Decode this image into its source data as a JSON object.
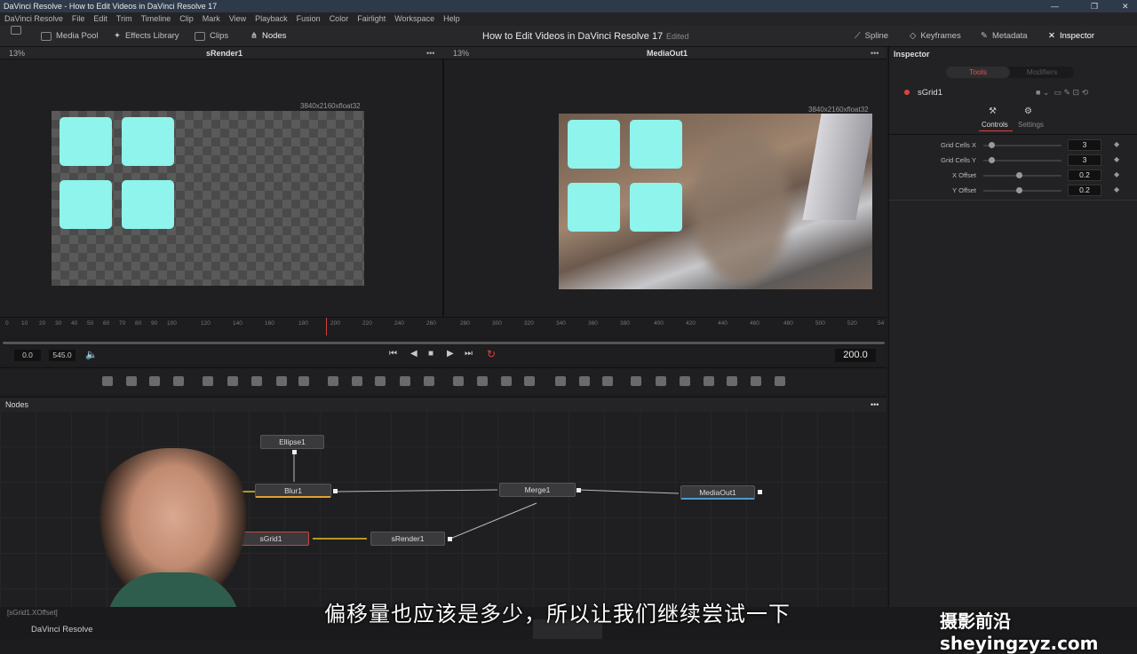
{
  "window": {
    "title": "DaVinci Resolve - How to Edit Videos in DaVinci Resolve 17"
  },
  "menu": [
    "DaVinci Resolve",
    "File",
    "Edit",
    "Trim",
    "Timeline",
    "Clip",
    "Mark",
    "View",
    "Playback",
    "Fusion",
    "Color",
    "Fairlight",
    "Workspace",
    "Help"
  ],
  "toolbar": {
    "media_pool": "Media Pool",
    "effects_library": "Effects Library",
    "clips": "Clips",
    "nodes": "Nodes",
    "project_title": "How to Edit Videos in DaVinci Resolve 17",
    "edited": "Edited",
    "spline": "Spline",
    "keyframes": "Keyframes",
    "metadata": "Metadata",
    "inspector": "Inspector"
  },
  "viewer_left": {
    "zoom": "13%",
    "name": "sRender1",
    "resolution": "3840x2160xfloat32"
  },
  "viewer_right": {
    "zoom": "13%",
    "name": "MediaOut1",
    "resolution": "3840x2160xfloat32"
  },
  "ruler_ticks": [
    "0",
    "10",
    "20",
    "30",
    "40",
    "50",
    "60",
    "70",
    "80",
    "90",
    "100",
    "120",
    "140",
    "160",
    "180",
    "200",
    "220",
    "240",
    "260",
    "280",
    "300",
    "320",
    "340",
    "360",
    "380",
    "400",
    "420",
    "440",
    "460",
    "480",
    "500",
    "520",
    "54"
  ],
  "transport": {
    "start": "0.0",
    "end": "545.0",
    "current": "200.0"
  },
  "nodes_panel": {
    "title": "Nodes",
    "nodes": {
      "ellipse": "Ellipse1",
      "blur": "Blur1",
      "merge": "Merge1",
      "mediaout": "MediaOut1",
      "sgrid": "sGrid1",
      "srender": "sRender1"
    }
  },
  "inspector": {
    "title": "Inspector",
    "tab_tools": "Tools",
    "tab_modifiers": "Modifiers",
    "tool_name": "sGrid1",
    "subtab_controls": "Controls",
    "subtab_settings": "Settings",
    "params": [
      {
        "label": "Grid Cells X",
        "value": "3",
        "level": 0.1
      },
      {
        "label": "Grid Cells Y",
        "value": "3",
        "level": 0.1
      },
      {
        "label": "X Offset",
        "value": "0.2",
        "level": 0.45
      },
      {
        "label": "Y Offset",
        "value": "0.2",
        "level": 0.45
      }
    ]
  },
  "status": {
    "left": "[sGrid1.XOffset]",
    "app": "DaVinci Resolve"
  },
  "subtitle": "偏移量也应该是多少，所以让我们继续尝试一下",
  "watermark": "摄影前沿 sheyingzyz.com",
  "colors": {
    "tile": "#8ef4ec",
    "accent_red": "#e04040",
    "playhead": "#d04040"
  }
}
